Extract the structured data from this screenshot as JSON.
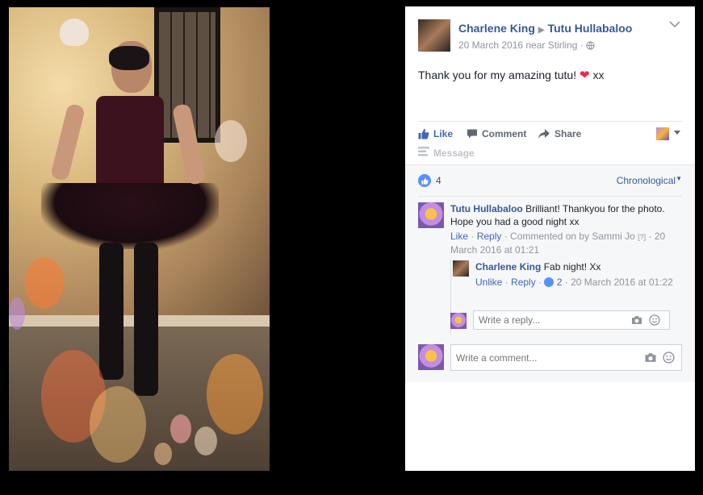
{
  "post": {
    "author": "Charlene King",
    "target": "Tutu Hullabaloo",
    "meta": "20 March 2016 near Stirling · ",
    "text": "Thank you for my amazing tutu!",
    "text_suffix": "xx",
    "emoji": "heart-emoji"
  },
  "actions": {
    "like_label": "Like",
    "comment_label": "Comment",
    "share_label": "Share",
    "message_label": "Message"
  },
  "reactions": {
    "count": "4",
    "sort_label": "Chronological"
  },
  "comments": [
    {
      "author": "Tutu Hullabaloo",
      "text": "Brilliant! Thankyou for the photo. Hope you had a good night xx",
      "like_label": "Like",
      "reply_label": "Reply",
      "edited_text": "Commented on by Sammi Jo",
      "help_marker": "[?]",
      "timestamp": "20 March 2016 at 01:21",
      "replies": [
        {
          "author": "Charlene King",
          "text": "Fab night! Xx",
          "unlike_label": "Unlike",
          "reply_label": "Reply",
          "like_count": "2",
          "timestamp": "20 March 2016 at 01:22"
        }
      ]
    }
  ],
  "inputs": {
    "reply_placeholder": "Write a reply...",
    "comment_placeholder": "Write a comment..."
  },
  "colors": {
    "link_blue": "#365899",
    "accent_blue": "#4267b2",
    "reaction_blue": "#5890ff",
    "muted_gray": "#90949c",
    "heart_red": "#f0284a"
  }
}
